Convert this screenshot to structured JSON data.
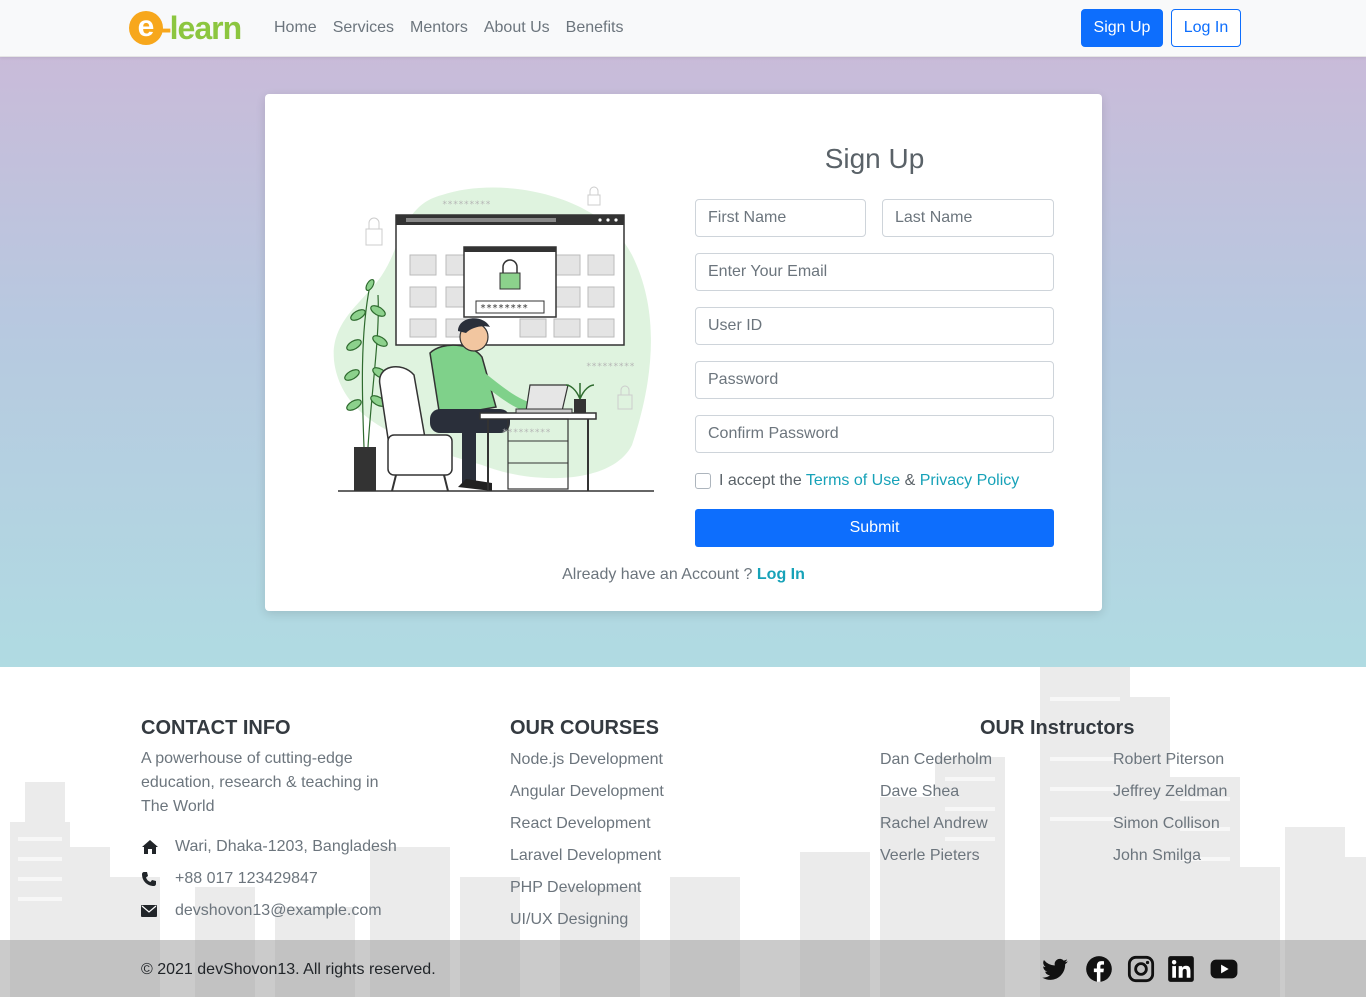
{
  "nav": {
    "logo_e": "e",
    "logo_rest": "learn",
    "links": [
      "Home",
      "Services",
      "Mentors",
      "About Us",
      "Benefits"
    ],
    "signup_label": "Sign Up",
    "login_label": "Log In"
  },
  "form": {
    "title": "Sign Up",
    "first_name_placeholder": "First Name",
    "last_name_placeholder": "Last Name",
    "email_placeholder": "Enter Your Email",
    "userid_placeholder": "User ID",
    "password_placeholder": "Password",
    "confirm_placeholder": "Confirm Password",
    "terms_prefix": "I accept the",
    "terms_link": "Terms of Use",
    "terms_amp": "&",
    "privacy_link": "Privacy Policy",
    "submit_label": "Submit",
    "already_text": "Already have an Account ?",
    "already_link": "Log In"
  },
  "footer": {
    "contact_title": "CONTACT INFO",
    "contact_desc": "A powerhouse of cutting-edge education, research & teaching in The World",
    "address": "Wari, Dhaka-1203, Bangladesh",
    "phone": "+88 017 123429847",
    "email": "devshovon13@example.com",
    "courses_title": "OUR COURSES",
    "courses": [
      "Node.js Development",
      "Angular Development",
      "React Development",
      "Laravel Development",
      "PHP Development",
      "UI/UX Designing"
    ],
    "instructors_title": "OUR Instructors",
    "instructors_left": [
      "Dan Cederholm",
      "Dave Shea",
      "Rachel Andrew",
      "Veerle Pieters"
    ],
    "instructors_right": [
      "Robert Piterson",
      "Jeffrey Zeldman",
      "Simon Collison",
      "John Smilga"
    ],
    "copyright": "© 2021 devShovon13. All rights reserved.",
    "social_icons": [
      "twitter-icon",
      "facebook-icon",
      "instagram-icon",
      "linkedin-icon",
      "youtube-icon"
    ]
  },
  "colors": {
    "primary": "#0d6efd",
    "link": "#17a2b8",
    "logo_orange": "#f7a71c",
    "logo_green": "#8cc63f"
  }
}
